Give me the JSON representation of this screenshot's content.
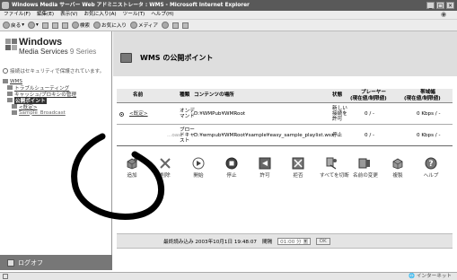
{
  "window": {
    "title": "Windows Media サーバー Web アドミニストレータ : WMS - Microsoft Internet Explorer",
    "controls": [
      "_",
      "□",
      "×"
    ]
  },
  "menu": [
    "ファイル(F)",
    "編集(E)",
    "表示(V)",
    "お気に入り(A)",
    "ツール(T)",
    "ヘルプ(H)"
  ],
  "toolbar": {
    "back": "戻る",
    "search": "検索",
    "favorites": "お気に入り",
    "media": "メディア"
  },
  "sidebar": {
    "logo_title": "Windows",
    "logo_subtitle": "Media Services",
    "logo_series": "9 Series",
    "security_text": "接続はセキュリティで保護されています。",
    "tree": [
      {
        "label": "WMS",
        "level": 0
      },
      {
        "label": "トラブルシューティング",
        "level": 1
      },
      {
        "label": "キャッシュ/プロキシの管理",
        "level": 1
      },
      {
        "label": "公開ポイント",
        "level": 1,
        "selected": true
      },
      {
        "label": "<既定>",
        "level": 2
      },
      {
        "label": "Sample_Broadcast",
        "level": 2
      }
    ],
    "logoff": "ログオフ"
  },
  "page": {
    "title": "WMS の公開ポイント"
  },
  "table": {
    "headers": {
      "name": "名前",
      "type": "種類",
      "content": "コンテンツの場所",
      "status": "状態",
      "players": "プレーヤー",
      "players_sub": "(現在値/制限値)",
      "bandwidth": "帯域幅",
      "bandwidth_sub": "(現在値/制限値)"
    },
    "rows": [
      {
        "name": "<既定>",
        "type": [
          "オンデ",
          "マンド"
        ],
        "content": "D:¥WMPub¥WMRoot",
        "status": [
          "新しい",
          "接続を",
          "許可"
        ],
        "players": "0 / -",
        "bandwidth": "0 Kbps / -",
        "selected": true
      },
      {
        "name": "...oast",
        "type": [
          "ブロー",
          "ドキャ",
          "スト"
        ],
        "content": "D:¥wmpub¥WMRoot¥sample¥easy_sample_playlist.wsx",
        "status": [
          "停止"
        ],
        "players": "0 / -",
        "bandwidth": "0 Kbps / -",
        "selected": false
      }
    ]
  },
  "actions": [
    {
      "label": "追加",
      "icon": "add-icon"
    },
    {
      "label": "削除",
      "icon": "delete-icon"
    },
    {
      "label": "開始",
      "icon": "start-icon"
    },
    {
      "label": "停止",
      "icon": "stop-icon"
    },
    {
      "label": "許可",
      "icon": "allow-icon"
    },
    {
      "label": "拒否",
      "icon": "deny-icon"
    },
    {
      "label": "すべてを切断",
      "icon": "disconnect-all-icon"
    },
    {
      "label": "名前の変更",
      "icon": "rename-icon"
    },
    {
      "label": "複製",
      "icon": "duplicate-icon"
    },
    {
      "label": "ヘルプ",
      "icon": "help-icon"
    }
  ],
  "refresh": {
    "text": "最終読み込み 2003年10月1日 19:48:07",
    "interval_label": "間隔",
    "interval_value": "01:00 分",
    "ok": "OK"
  },
  "statusbar": {
    "zone": "インターネット"
  }
}
